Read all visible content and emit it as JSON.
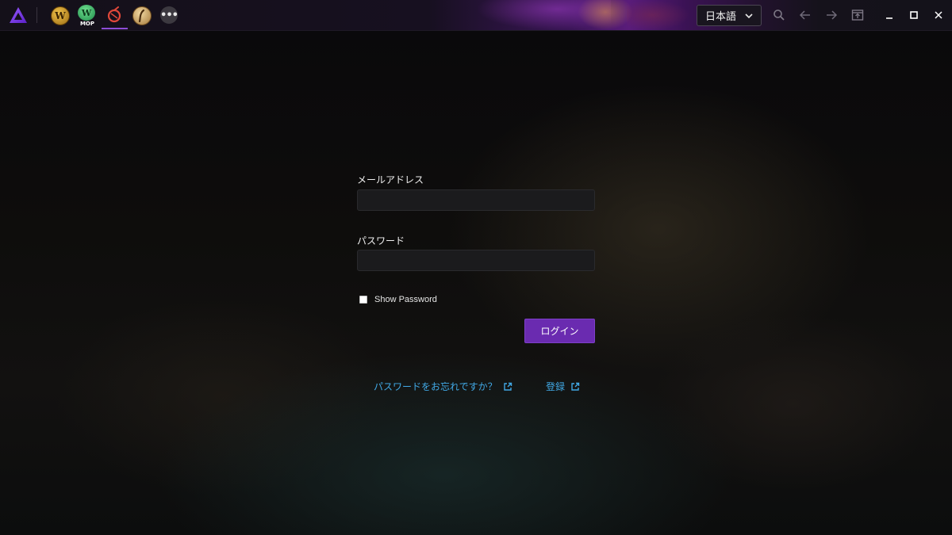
{
  "titlebar": {
    "games": [
      {
        "icon": "wow-icon",
        "letter": "W"
      },
      {
        "icon": "wow-mop-icon",
        "letter": "W",
        "badge": "MOP"
      },
      {
        "icon": "ffxiv-icon"
      },
      {
        "icon": "guild-wars-icon"
      }
    ],
    "more_icon": "more-icon",
    "more_glyph": "•••",
    "language": "日本語",
    "colors": {
      "accent": "#8c4cd6",
      "brand": "#7b3fe4"
    }
  },
  "login": {
    "email_label": "メールアドレス",
    "email_value": "",
    "password_label": "パスワード",
    "password_value": "",
    "show_password_label": "Show Password",
    "show_password_checked": false,
    "submit_label": "ログイン",
    "forgot_password_label": "パスワードをお忘れですか？",
    "register_label": "登録",
    "colors": {
      "button": "#6a2bb0",
      "link": "#41a9e6"
    }
  }
}
